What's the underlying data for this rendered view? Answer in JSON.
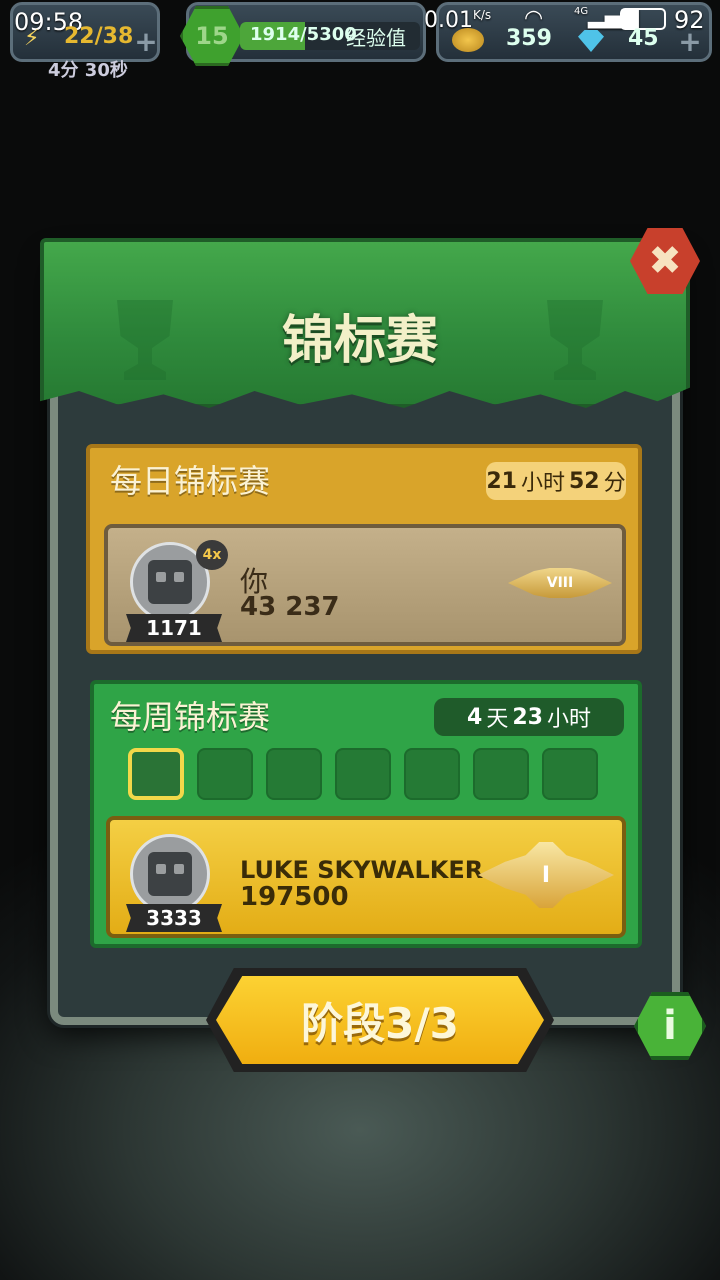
{
  "status_bar": {
    "time": "09:58",
    "network_speed": "0.01",
    "network_unit": "K/s",
    "signal_label": "4G",
    "battery": "92"
  },
  "hud": {
    "energy": "22/38",
    "energy_regen": "4分 30秒",
    "level": "15",
    "xp": "1914/5300",
    "xp_progress": 0.361,
    "xp_label": "经验值",
    "coins": "359",
    "gems": "45"
  },
  "panel": {
    "title": "锦标赛",
    "close_glyph": "✖"
  },
  "daily": {
    "title": "每日锦标赛",
    "timer_hours": "21",
    "timer_hours_unit": "小时",
    "timer_minutes": "52",
    "timer_minutes_unit": "分",
    "player": {
      "name": "你",
      "score": "43 237",
      "rank": "1171",
      "multiplier": "4x",
      "league": "VIII"
    }
  },
  "weekly": {
    "title": "每周锦标赛",
    "timer_days": "4",
    "timer_days_unit": "天",
    "timer_hours": "23",
    "timer_hours_unit": "小时",
    "stages_total": 7,
    "current_stage_index": 0,
    "leader": {
      "name": "LUKE SKYWALKER",
      "score": "197500",
      "rank": "3333",
      "league": "I"
    }
  },
  "buttons": {
    "stage_label": "阶段3/3",
    "info_glyph": "i"
  },
  "colors": {
    "banner_green": "#2f8a3c",
    "daily_gold": "#d9a42a",
    "weekly_green": "#2fa447",
    "close_red": "#c8402c",
    "stage_yellow": "#f0ae10"
  }
}
